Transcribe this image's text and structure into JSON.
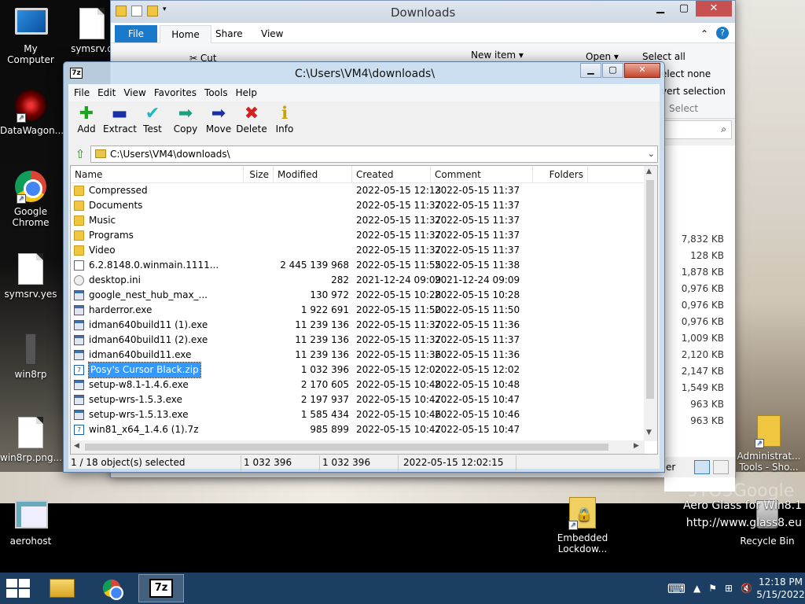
{
  "desktop": {
    "icons": [
      {
        "label": "My Computer"
      },
      {
        "label": "symsrv.d"
      },
      {
        "label": "DataWagon..."
      },
      {
        "label": "Google Chrome"
      },
      {
        "label": "symsrv.yes"
      },
      {
        "label": "win8rp"
      },
      {
        "label": "win8rp.png...."
      },
      {
        "label": "aerohost"
      },
      {
        "label": "Embedded Lockdow..."
      },
      {
        "label": "Administrat... Tools - Sho..."
      },
      {
        "label": "Recycle Bin"
      }
    ],
    "watermark": "9TO5Google",
    "aero_line1": "Aero Glass for Win8.1",
    "aero_line2": "http://www.glass8.eu"
  },
  "explorer": {
    "title": "Downloads",
    "tabs": [
      "File",
      "Home",
      "Share",
      "View"
    ],
    "ribbon": {
      "cut": "Cut",
      "new_item": "New item",
      "open": "Open",
      "select_all": "Select all",
      "select_none": "elect none",
      "invert": "vert selection",
      "select": "Select"
    },
    "sizes": [
      "7,832 KB",
      "128 KB",
      "1,878 KB",
      "0,976 KB",
      "0,976 KB",
      "0,976 KB",
      "1,009 KB",
      "2,120 KB",
      "2,147 KB",
      "1,549 KB",
      "963 KB",
      "963 KB"
    ],
    "status_fragment": "er",
    "tools_fragment": "Tools - Sho..."
  },
  "sevenzip": {
    "title": "C:\\Users\\VM4\\downloads\\",
    "menu": [
      "File",
      "Edit",
      "View",
      "Favorites",
      "Tools",
      "Help"
    ],
    "toolbar": [
      {
        "label": "Add",
        "icon": "add-icon",
        "glyph": "✚",
        "color": "#1aa51a"
      },
      {
        "label": "Extract",
        "icon": "extract-icon",
        "glyph": "▬",
        "color": "#1b2fa5"
      },
      {
        "label": "Test",
        "icon": "test-icon",
        "glyph": "✔",
        "color": "#20b8c8"
      },
      {
        "label": "Copy",
        "icon": "copy-icon",
        "glyph": "➡",
        "color": "#1aa080"
      },
      {
        "label": "Move",
        "icon": "move-icon",
        "glyph": "➡",
        "color": "#1b2fa5"
      },
      {
        "label": "Delete",
        "icon": "delete-icon",
        "glyph": "✖",
        "color": "#d42020"
      },
      {
        "label": "Info",
        "icon": "info-icon",
        "glyph": "ℹ",
        "color": "#c8a400"
      }
    ],
    "address": "C:\\Users\\VM4\\downloads\\",
    "columns": [
      "Name",
      "Size",
      "Modified",
      "Created",
      "Comment",
      "Folders"
    ],
    "rows": [
      {
        "name": "Compressed",
        "type": "folder",
        "size": "",
        "modified": "2022-05-15 12:13",
        "created": "2022-05-15 11:37"
      },
      {
        "name": "Documents",
        "type": "folder",
        "size": "",
        "modified": "2022-05-15 11:37",
        "created": "2022-05-15 11:37"
      },
      {
        "name": "Music",
        "type": "folder",
        "size": "",
        "modified": "2022-05-15 11:37",
        "created": "2022-05-15 11:37"
      },
      {
        "name": "Programs",
        "type": "folder",
        "size": "",
        "modified": "2022-05-15 11:37",
        "created": "2022-05-15 11:37"
      },
      {
        "name": "Video",
        "type": "folder",
        "size": "",
        "modified": "2022-05-15 11:37",
        "created": "2022-05-15 11:37"
      },
      {
        "name": "6.2.8148.0.winmain.1111...",
        "type": "file",
        "size": "2 445 139 968",
        "modified": "2022-05-15 11:55",
        "created": "2022-05-15 11:38"
      },
      {
        "name": "desktop.ini",
        "type": "gear",
        "size": "282",
        "modified": "2021-12-24 09:09",
        "created": "2021-12-24 09:09"
      },
      {
        "name": "google_nest_hub_max_...",
        "type": "exe",
        "size": "130 972",
        "modified": "2022-05-15 10:28",
        "created": "2022-05-15 10:28"
      },
      {
        "name": "harderror.exe",
        "type": "exe",
        "size": "1 922 691",
        "modified": "2022-05-15 11:50",
        "created": "2022-05-15 11:50"
      },
      {
        "name": "idman640build11 (1).exe",
        "type": "exe",
        "size": "11 239 136",
        "modified": "2022-05-15 11:37",
        "created": "2022-05-15 11:36"
      },
      {
        "name": "idman640build11 (2).exe",
        "type": "exe",
        "size": "11 239 136",
        "modified": "2022-05-15 11:37",
        "created": "2022-05-15 11:37"
      },
      {
        "name": "idman640build11.exe",
        "type": "exe",
        "size": "11 239 136",
        "modified": "2022-05-15 11:36",
        "created": "2022-05-15 11:36"
      },
      {
        "name": "Posy's Cursor Black.zip",
        "type": "zip",
        "size": "1 032 396",
        "modified": "2022-05-15 12:02",
        "created": "2022-05-15 12:02",
        "selected": true
      },
      {
        "name": "setup-w8.1-1.4.6.exe",
        "type": "exe",
        "size": "2 170 605",
        "modified": "2022-05-15 10:48",
        "created": "2022-05-15 10:48"
      },
      {
        "name": "setup-wrs-1.5.3.exe",
        "type": "exe",
        "size": "2 197 937",
        "modified": "2022-05-15 10:47",
        "created": "2022-05-15 10:47"
      },
      {
        "name": "setup-wrs-1.5.13.exe",
        "type": "exe",
        "size": "1 585 434",
        "modified": "2022-05-15 10:46",
        "created": "2022-05-15 10:46"
      },
      {
        "name": "win81_x64_1.4.6 (1).7z",
        "type": "zip",
        "size": "985 899",
        "modified": "2022-05-15 10:47",
        "created": "2022-05-15 10:47"
      }
    ],
    "status": {
      "selected": "1 / 18 object(s) selected",
      "size": "1 032 396",
      "packed": "1 032 396",
      "date": "2022-05-15 12:02:15"
    }
  },
  "taskbar": {
    "time": "12:18 PM",
    "date": "5/15/2022",
    "active_app": "7z"
  }
}
